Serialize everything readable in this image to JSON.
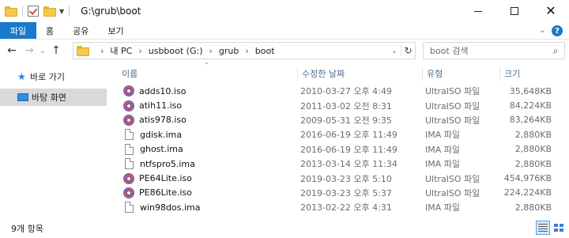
{
  "window": {
    "title": "G:\\grub\\boot"
  },
  "ribbon": {
    "tabs": [
      "파일",
      "홈",
      "공유",
      "보기"
    ]
  },
  "address": {
    "breadcrumbs": [
      "내 PC",
      "usbboot (G:)",
      "grub",
      "boot"
    ]
  },
  "search": {
    "placeholder": "boot 검색"
  },
  "sidebar": {
    "items": [
      {
        "label": "바로 가기",
        "icon": "star-icon"
      },
      {
        "label": "바탕 화면",
        "icon": "desktop-icon",
        "selected": true
      }
    ]
  },
  "columns": {
    "name": "이름",
    "date": "수정한 날짜",
    "type": "유형",
    "size": "크기"
  },
  "files": [
    {
      "name": "adds10.iso",
      "date": "2010-03-27 오후 4:49",
      "type": "UltraISO 파일",
      "size": "35,648KB",
      "icon": "disc-image-icon"
    },
    {
      "name": "atih11.iso",
      "date": "2011-03-02 오전 8:31",
      "type": "UltraISO 파일",
      "size": "84,224KB",
      "icon": "disc-image-icon"
    },
    {
      "name": "atis978.iso",
      "date": "2009-05-31 오전 9:35",
      "type": "UltraISO 파일",
      "size": "83,264KB",
      "icon": "disc-image-icon"
    },
    {
      "name": "gdisk.ima",
      "date": "2016-06-19 오후 11:49",
      "type": "IMA 파일",
      "size": "2,880KB",
      "icon": "file-icon"
    },
    {
      "name": "ghost.ima",
      "date": "2016-06-19 오후 11:49",
      "type": "IMA 파일",
      "size": "2,880KB",
      "icon": "file-icon"
    },
    {
      "name": "ntfspro5.ima",
      "date": "2013-03-14 오후 11:34",
      "type": "IMA 파일",
      "size": "2,880KB",
      "icon": "file-icon"
    },
    {
      "name": "PE64Lite.iso",
      "date": "2019-03-23 오후 5:10",
      "type": "UltraISO 파일",
      "size": "454,976KB",
      "icon": "disc-image-icon"
    },
    {
      "name": "PE86Lite.iso",
      "date": "2019-03-23 오후 5:37",
      "type": "UltraISO 파일",
      "size": "224,224KB",
      "icon": "disc-image-icon"
    },
    {
      "name": "win98dos.ima",
      "date": "2013-02-22 오후 4:31",
      "type": "IMA 파일",
      "size": "2,880KB",
      "icon": "file-icon"
    }
  ],
  "status": {
    "item_count": "9개 항목"
  },
  "colors": {
    "accent": "#1979ca",
    "header_text": "#4d6f92",
    "selection": "#d9d9d9"
  }
}
